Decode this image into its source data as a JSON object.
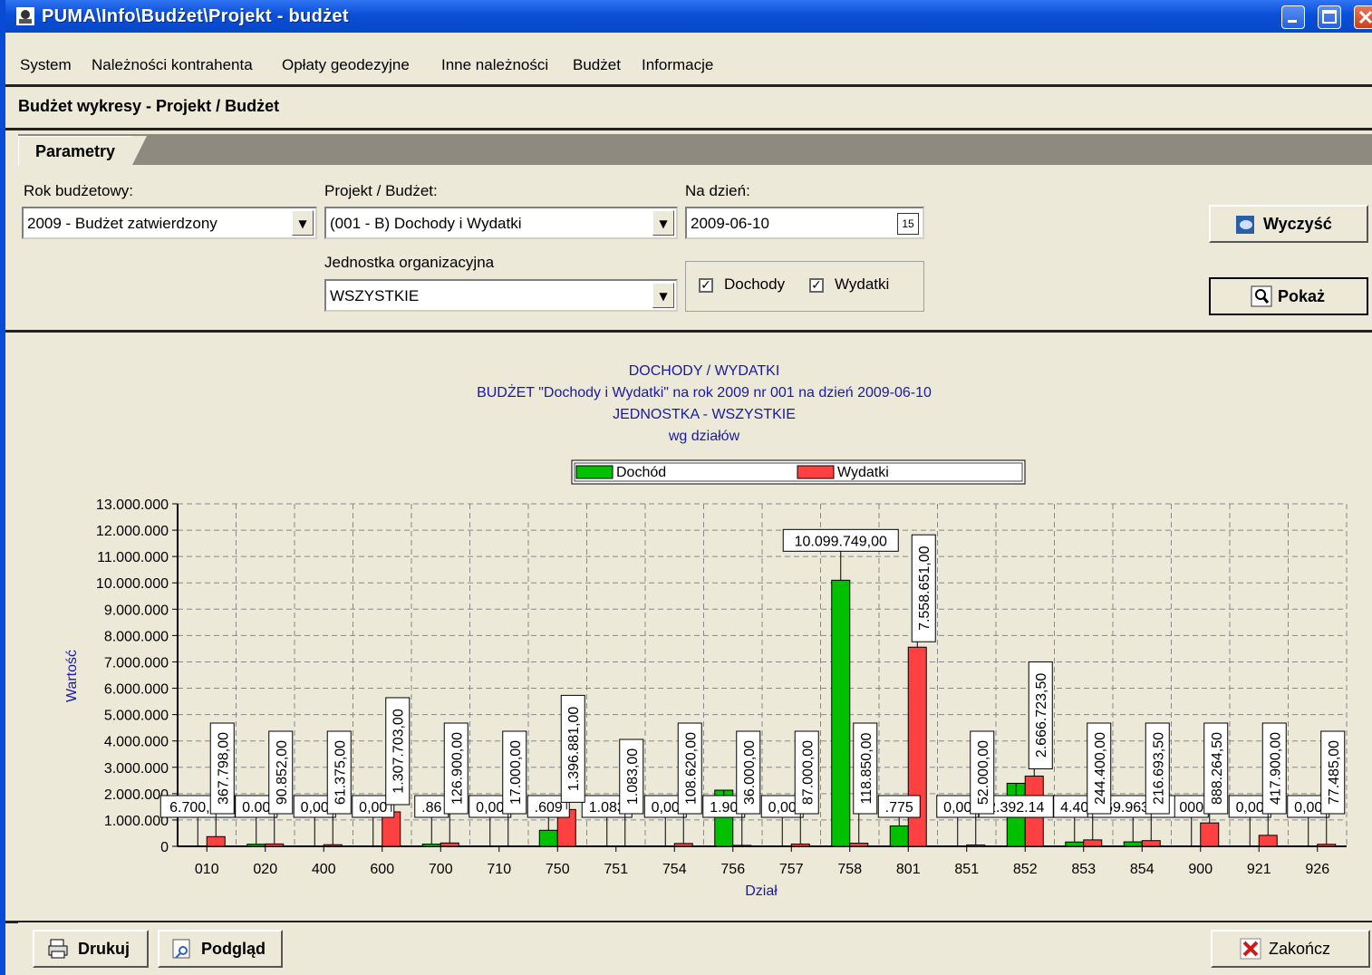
{
  "window": {
    "title": "PUMA\\Info\\Budżet\\Projekt - budżet"
  },
  "menu": [
    "System",
    "Należności kontrahenta",
    "Opłaty geodezyjne",
    "Inne należności",
    "Budżet",
    "Informacje"
  ],
  "form": {
    "title": "Budżet wykresy - Projekt / Budżet",
    "tab": "Parametry",
    "rok_label": "Rok budżetowy:",
    "rok_value": "2009 - Budżet zatwierdzony",
    "projekt_label": "Projekt / Budżet:",
    "projekt_value": "(001 - B) Dochody i Wydatki",
    "dzien_label": "Na dzień:",
    "dzien_value": "2009-06-10",
    "jednostka_label": "Jednostka organizacyjna",
    "jednostka_value": "WSZYSTKIE",
    "chk_dochody": "Dochody",
    "chk_wydatki": "Wydatki",
    "btn_clear": "Wyczyść",
    "btn_show": "Pokaż",
    "calendar_icon_text": "15"
  },
  "footer": {
    "print": "Drukuj",
    "preview": "Podgląd",
    "close": "Zakończ"
  },
  "colors": {
    "dochod": "#00c000",
    "wydatki": "#ff4040",
    "title_blue": "#1a1aa0"
  },
  "chart_data": {
    "type": "bar",
    "title": [
      "DOCHODY / WYDATKI",
      "BUDŻET \"Dochody i Wydatki\" na rok 2009 nr 001 na dzień 2009-06-10",
      "JEDNOSTKA - WSZYSTKIE",
      "wg działów"
    ],
    "xlabel": "Dział",
    "ylabel": "Wartość",
    "ylim": [
      0,
      13000000
    ],
    "yticks": [
      "0",
      "1.000.000",
      "2.000.000",
      "3.000.000",
      "4.000.000",
      "5.000.000",
      "6.000.000",
      "7.000.000",
      "8.000.000",
      "9.000.000",
      "10.000.000",
      "11.000.000",
      "12.000.000",
      "13.000.000"
    ],
    "legend": [
      "Dochód",
      "Wydatki"
    ],
    "legend_position": "top-center",
    "grid": true,
    "categories": [
      "010",
      "020",
      "400",
      "600",
      "700",
      "710",
      "750",
      "751",
      "754",
      "756",
      "757",
      "758",
      "801",
      "851",
      "852",
      "853",
      "854",
      "900",
      "921",
      "926"
    ],
    "series": [
      {
        "name": "Dochód",
        "values": [
          6700,
          80000,
          0,
          0,
          86000,
          0,
          609000,
          1083,
          0,
          2131900,
          0,
          10099749,
          775000,
          0,
          2392140,
          164400,
          169963.5,
          1000,
          0,
          0
        ],
        "labels": [
          "6.700,00",
          "0.00",
          "0,00",
          "0,00",
          ".86",
          "0,00",
          ".609",
          "1.083",
          "0,00",
          "1.90",
          "0,00",
          "10.099.749,00",
          ".775",
          "0,00",
          "2.392.14",
          "4.40",
          "169.963,50",
          "000",
          "0,00",
          "0,00"
        ]
      },
      {
        "name": "Wydatki",
        "values": [
          367798,
          90852,
          61375,
          1307703,
          126900,
          17000,
          1396881,
          1083,
          108620,
          36000,
          87000,
          118850,
          7558651,
          52000,
          2666723.5,
          244400,
          216693.5,
          888264.5,
          417900,
          77485
        ],
        "labels": [
          "367.798,00",
          "90.852,00",
          "61.375,00",
          "1.307.703,00",
          "126.900,00",
          "17.000,00",
          "1.396.881,00",
          "1.083,00",
          "108.620,00",
          "36.000,00",
          "87.000,00",
          "118.850,00",
          "7.558.651,00",
          "52.000,00",
          "2.666.723,50",
          "244.400,00",
          "216.693,50",
          "888.264,50",
          "417.900,00",
          "77.485,00"
        ]
      }
    ]
  }
}
